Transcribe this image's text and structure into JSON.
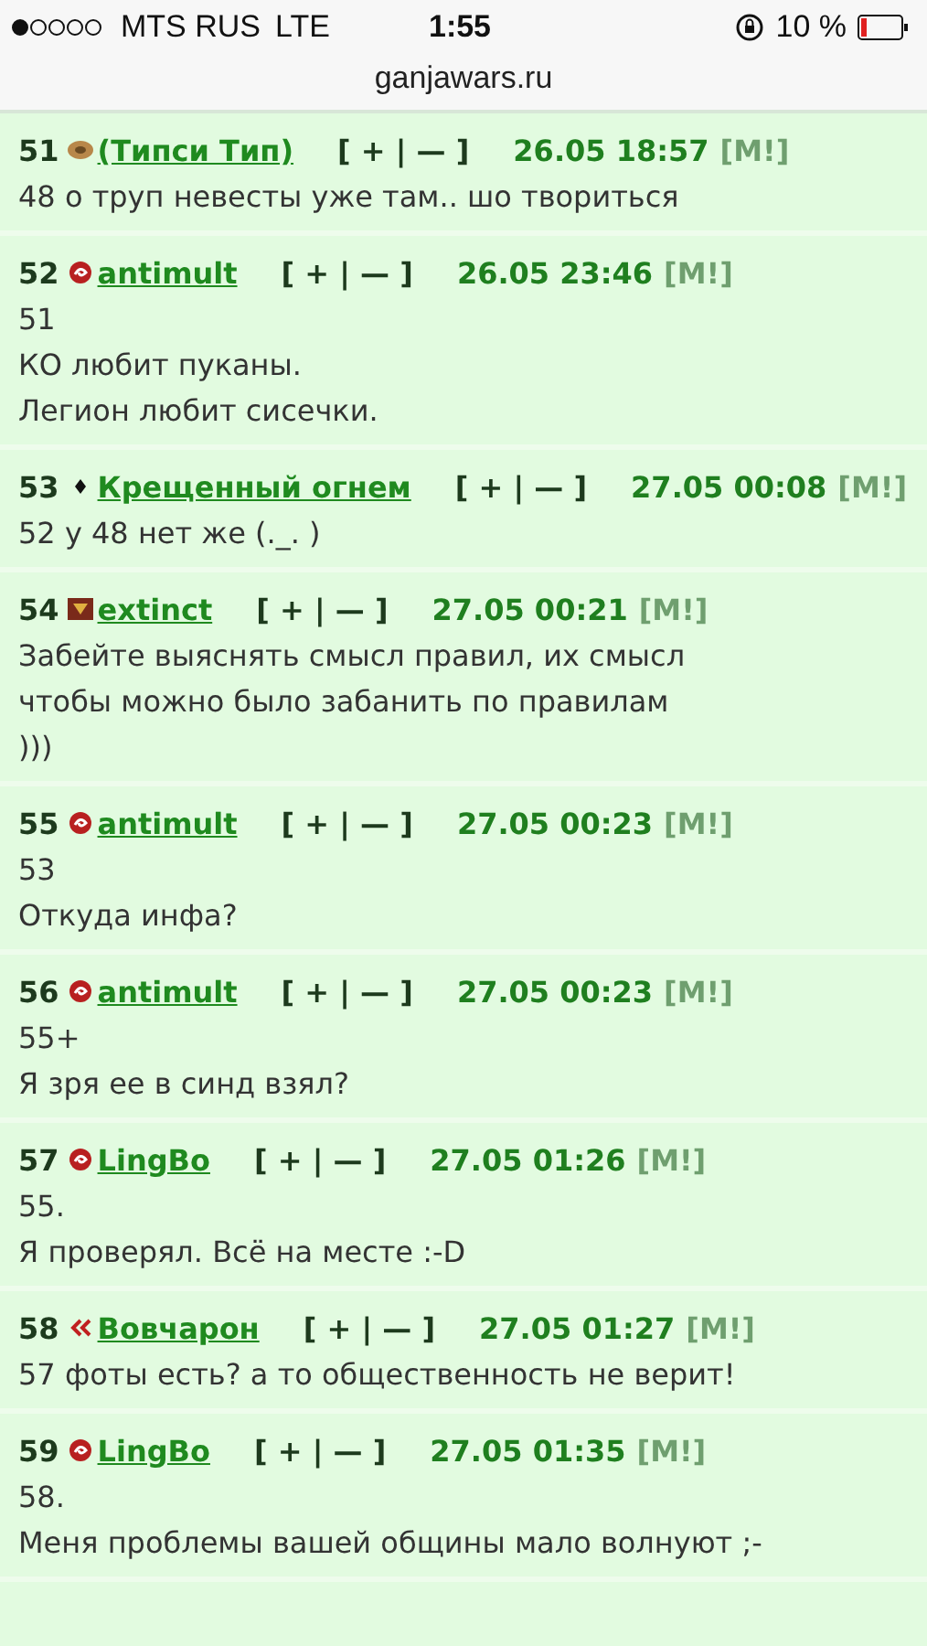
{
  "status_bar": {
    "carrier": "MTS RUS",
    "network": "LTE",
    "time": "1:55",
    "battery": "10 %"
  },
  "address_bar": {
    "url": "ganjawars.ru"
  },
  "posts": [
    {
      "number": "51",
      "kind": "beer",
      "author": "(Типси Тип)",
      "vote": "[ + | — ]",
      "date": "26.05 18:57",
      "mod": "[M!]",
      "lines": [
        "48 о труп невесты уже там.. шо твориться"
      ]
    },
    {
      "number": "52",
      "kind": "swirl",
      "author": "antimult",
      "vote": "[ + | — ]",
      "date": "26.05 23:46",
      "mod": "[M!]",
      "lines": [
        "51",
        "КО любит пуканы.",
        "Легион любит сисечки."
      ]
    },
    {
      "number": "53",
      "kind": "diamond",
      "author": "Крещенный огнем",
      "vote": "[ + | — ]",
      "date": "27.05 00:08",
      "mod": "[M!]",
      "lines": [
        "52 у 48 нет же (._. )"
      ]
    },
    {
      "number": "54",
      "kind": "crest",
      "author": "extinct",
      "vote": "[ + | — ]",
      "date": "27.05 00:21",
      "mod": "[M!]",
      "lines": [
        "Забейте выяснять смысл правил, их смысл",
        "чтобы можно было забанить по правилам",
        ")))"
      ]
    },
    {
      "number": "55",
      "kind": "swirl",
      "author": "antimult",
      "vote": "[ + | — ]",
      "date": "27.05 00:23",
      "mod": "[M!]",
      "lines": [
        "53",
        "Откуда инфа?"
      ]
    },
    {
      "number": "56",
      "kind": "swirl",
      "author": "antimult",
      "vote": "[ + | — ]",
      "date": "27.05 00:23",
      "mod": "[M!]",
      "lines": [
        "55+",
        "Я зря ее в синд взял?"
      ]
    },
    {
      "number": "57",
      "kind": "swirl",
      "author": "LingBo",
      "vote": "[ + | — ]",
      "date": "27.05 01:26",
      "mod": "[M!]",
      "lines": [
        "55.",
        "Я проверял. Всё на месте :-D"
      ]
    },
    {
      "number": "58",
      "kind": "chevron",
      "author": "Вовчарон",
      "vote": "[ + | — ]",
      "date": "27.05 01:27",
      "mod": "[M!]",
      "lines": [
        "57 фоты есть? а то общественность не верит!"
      ]
    },
    {
      "number": "59",
      "kind": "swirl",
      "author": "LingBo",
      "vote": "[ + | — ]",
      "date": "27.05 01:35",
      "mod": "[M!]",
      "lines": [
        "58.",
        "Меня проблемы вашей общины мало волнуют ;-"
      ]
    }
  ]
}
